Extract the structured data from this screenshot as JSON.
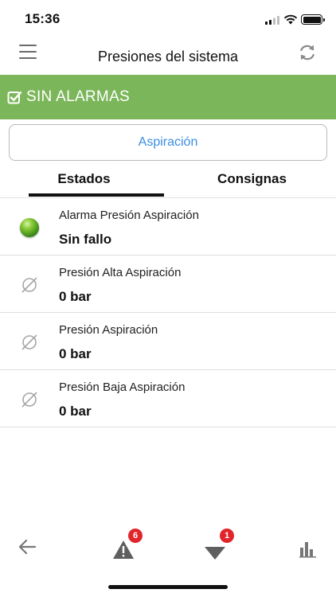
{
  "status_bar": {
    "time": "15:36"
  },
  "nav": {
    "title": "Presiones del sistema",
    "menu_icon": "hamburger-icon",
    "refresh_icon": "refresh-icon"
  },
  "banner": {
    "text": "SIN ALARMAS",
    "color": "#7cb65a",
    "icon": "checkbox-checked-icon"
  },
  "section_button": {
    "label": "Aspiración",
    "color": "#3b8ee0"
  },
  "tabs": [
    {
      "label": "Estados",
      "active": true
    },
    {
      "label": "Consignas",
      "active": false
    }
  ],
  "items": [
    {
      "label": "Alarma Presión Aspiración",
      "value": "Sin fallo",
      "icon": "green-led-icon"
    },
    {
      "label": "Presión Alta Aspiración",
      "value": "0 bar",
      "icon": "empty-set-icon"
    },
    {
      "label": "Presión Aspiración",
      "value": "0 bar",
      "icon": "empty-set-icon"
    },
    {
      "label": "Presión Baja Aspiración",
      "value": "0 bar",
      "icon": "empty-set-icon"
    }
  ],
  "bottom_nav": {
    "back_icon": "back-arrow-icon",
    "alarms": {
      "icon": "warning-triangle-icon",
      "badge": "6"
    },
    "notices": {
      "icon": "down-triangle-icon",
      "badge": "1"
    },
    "charts_icon": "bar-chart-icon",
    "badge_color": "#e0252b"
  }
}
